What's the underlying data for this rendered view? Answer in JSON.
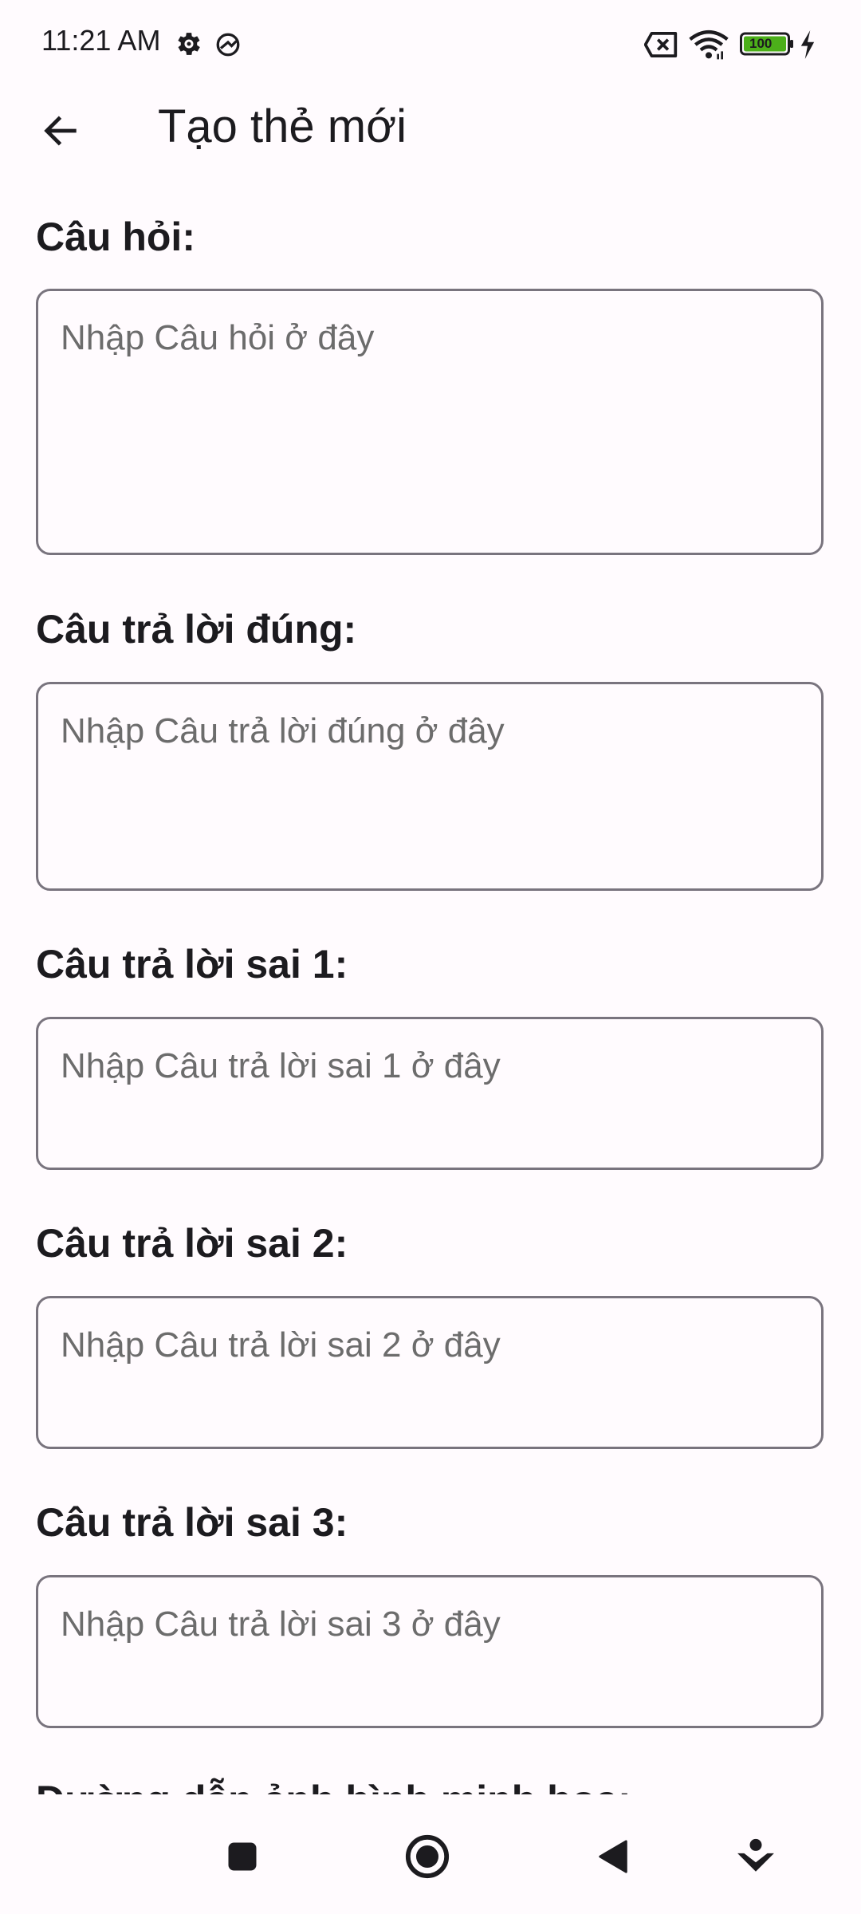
{
  "status_bar": {
    "time": "11:21 AM",
    "battery_level": "100",
    "icons": [
      "settings-gear-icon",
      "vpn-icon",
      "no-sim-icon",
      "wifi-icon",
      "battery-icon",
      "charging-icon"
    ]
  },
  "app_bar": {
    "title": "Tạo thẻ mới",
    "back_icon": "arrow-back-icon"
  },
  "form": {
    "fields": [
      {
        "label": "Câu hỏi:",
        "placeholder": "Nhập Câu hỏi ở đây",
        "value": ""
      },
      {
        "label": "Câu trả lời đúng:",
        "placeholder": "Nhập Câu trả lời đúng ở đây",
        "value": ""
      },
      {
        "label": "Câu trả lời sai 1:",
        "placeholder": "Nhập Câu trả lời sai 1 ở đây",
        "value": ""
      },
      {
        "label": "Câu trả lời sai 2:",
        "placeholder": "Nhập Câu trả lời sai 2 ở đây",
        "value": ""
      },
      {
        "label": "Câu trả lời sai 3:",
        "placeholder": "Nhập Câu trả lời sai 3 ở đây",
        "value": ""
      }
    ],
    "partial_label": "Đường dẫn ảnh hình minh họa:"
  },
  "nav_bar": {
    "icons": [
      "recents-square-icon",
      "home-circle-icon",
      "back-triangle-icon",
      "assistant-icon"
    ]
  },
  "colors": {
    "background": "#fffbfe",
    "outline": "#79747e",
    "text": "#1c1b1f",
    "placeholder": "#6c6c6c",
    "battery_fill": "#4caf1a"
  }
}
